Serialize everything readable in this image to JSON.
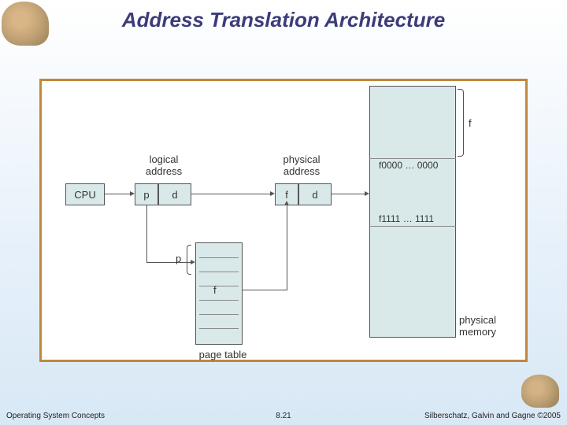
{
  "title": "Address Translation Architecture",
  "diagram": {
    "cpu": "CPU",
    "logical_address_label": "logical\naddress",
    "physical_address_label": "physical\naddress",
    "p": "p",
    "d": "d",
    "f": "f",
    "page_table_label": "page table",
    "physical_memory_label": "physical\nmemory",
    "frame_top": "f0000 … 0000",
    "frame_bottom": "f1111 … 1111",
    "f_brace": "f"
  },
  "footer": {
    "left": "Operating System Concepts",
    "center": "8.21",
    "right": "Silberschatz, Galvin and Gagne ©2005"
  }
}
